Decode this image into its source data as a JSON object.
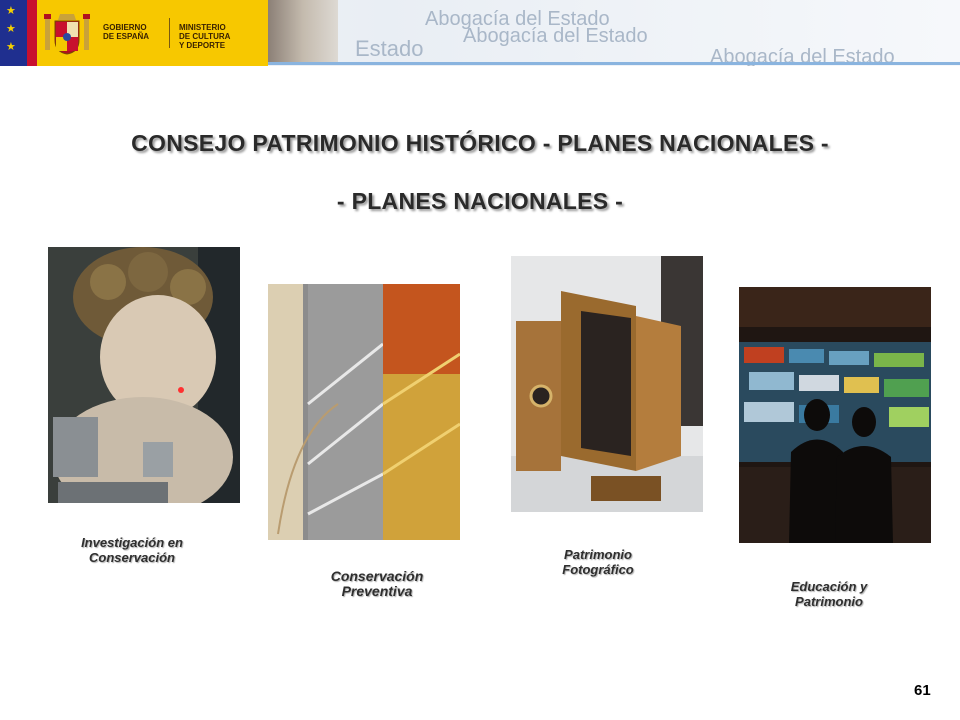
{
  "header": {
    "gov_line1": "GOBIERNO",
    "gov_line2": "DE ESPAÑA",
    "min_line1": "MINISTERIO",
    "min_line2": "DE CULTURA",
    "min_line3": "Y DEPORTE",
    "watermark_1": "Abogacía del Estado",
    "watermark_2": "Abogacía del Estado",
    "watermark_3": "Estado",
    "watermark_4": "Abogacía del Estado"
  },
  "title": {
    "line1": "CONSEJO PATRIMONIO HISTÓRICO - PLANES NACIONALES -",
    "line2": "- PLANES NACIONALES -"
  },
  "cards": [
    {
      "caption_line1": "Investigación en",
      "caption_line2": "Conservación"
    },
    {
      "caption_line1": "Conservación",
      "caption_line2": "Preventiva"
    },
    {
      "caption_line1": "Patrimonio",
      "caption_line2": "Fotográfico"
    },
    {
      "caption_line1": "Educación y",
      "caption_line2": "Patrimonio"
    }
  ],
  "page_number": "61",
  "colors": {
    "logo_yellow": "#f7c800",
    "eu_blue": "#1f2f8f",
    "spain_red": "#c8102e",
    "header_accent": "#8ab4df"
  }
}
